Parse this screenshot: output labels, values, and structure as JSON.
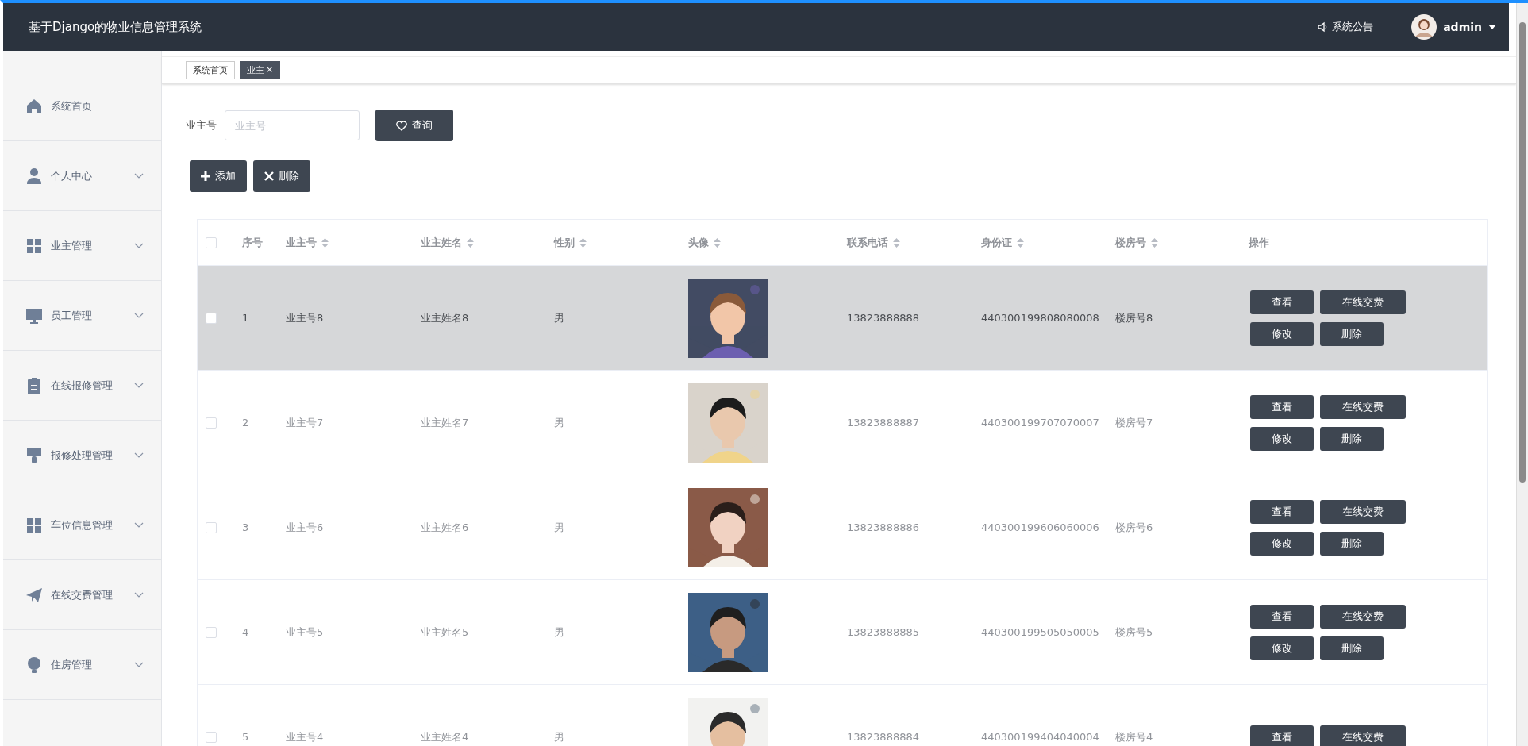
{
  "header": {
    "title": "基于Django的物业信息管理系统",
    "notice": "系统公告",
    "user": "admin"
  },
  "tabs": [
    {
      "label": "系统首页",
      "selected": false,
      "closable": false
    },
    {
      "label": "业主",
      "selected": true,
      "closable": true,
      "close": "×"
    }
  ],
  "sidebar": {
    "items": [
      {
        "label": "系统首页",
        "expandable": false
      },
      {
        "label": "个人中心",
        "expandable": true
      },
      {
        "label": "业主管理",
        "expandable": true
      },
      {
        "label": "员工管理",
        "expandable": true
      },
      {
        "label": "在线报修管理",
        "expandable": true
      },
      {
        "label": "报修处理管理",
        "expandable": true
      },
      {
        "label": "车位信息管理",
        "expandable": true
      },
      {
        "label": "在线交费管理",
        "expandable": true
      },
      {
        "label": "住房管理",
        "expandable": true
      }
    ]
  },
  "search": {
    "label": "业主号",
    "placeholder": "业主号",
    "button": "查询"
  },
  "toolbar": [
    {
      "kind": "add",
      "label": "添加"
    },
    {
      "kind": "delete",
      "label": "删除"
    }
  ],
  "table": {
    "columns": [
      {
        "label": "序号",
        "sortable": false
      },
      {
        "label": "业主号",
        "sortable": true
      },
      {
        "label": "业主姓名",
        "sortable": true
      },
      {
        "label": "性别",
        "sortable": true
      },
      {
        "label": "头像",
        "sortable": true
      },
      {
        "label": "联系电话",
        "sortable": true
      },
      {
        "label": "身份证",
        "sortable": true
      },
      {
        "label": "楼房号",
        "sortable": true
      },
      {
        "label": "操作",
        "sortable": false
      }
    ],
    "select_all_checked": false,
    "rows": [
      {
        "selected": true,
        "checked": false,
        "cells": [
          "1",
          "业主号8",
          "业主姓名8",
          "男",
          {
            "kind": "picture"
          },
          "13823888888",
          "440300199808080008",
          "楼房号8"
        ],
        "actions": [
          "查看",
          "在线交费",
          "修改",
          "删除"
        ]
      },
      {
        "selected": false,
        "checked": false,
        "cells": [
          "2",
          "业主号7",
          "业主姓名7",
          "男",
          {
            "kind": "picture"
          },
          "13823888887",
          "440300199707070007",
          "楼房号7"
        ],
        "actions": [
          "查看",
          "在线交费",
          "修改",
          "删除"
        ]
      },
      {
        "selected": false,
        "checked": false,
        "cells": [
          "3",
          "业主号6",
          "业主姓名6",
          "男",
          {
            "kind": "picture"
          },
          "13823888886",
          "440300199606060006",
          "楼房号6"
        ],
        "actions": [
          "查看",
          "在线交费",
          "修改",
          "删除"
        ]
      },
      {
        "selected": false,
        "checked": false,
        "cells": [
          "4",
          "业主号5",
          "业主姓名5",
          "男",
          {
            "kind": "picture"
          },
          "13823888885",
          "440300199505050005",
          "楼房号5"
        ],
        "actions": [
          "查看",
          "在线交费",
          "修改",
          "删除"
        ]
      },
      {
        "selected": false,
        "checked": false,
        "cells": [
          "5",
          "业主号4",
          "业主姓名4",
          "男",
          {
            "kind": "picture"
          },
          "13823888884",
          "440300199404040004",
          "楼房号4"
        ],
        "actions": [
          "查看",
          "在线交费"
        ]
      }
    ]
  }
}
